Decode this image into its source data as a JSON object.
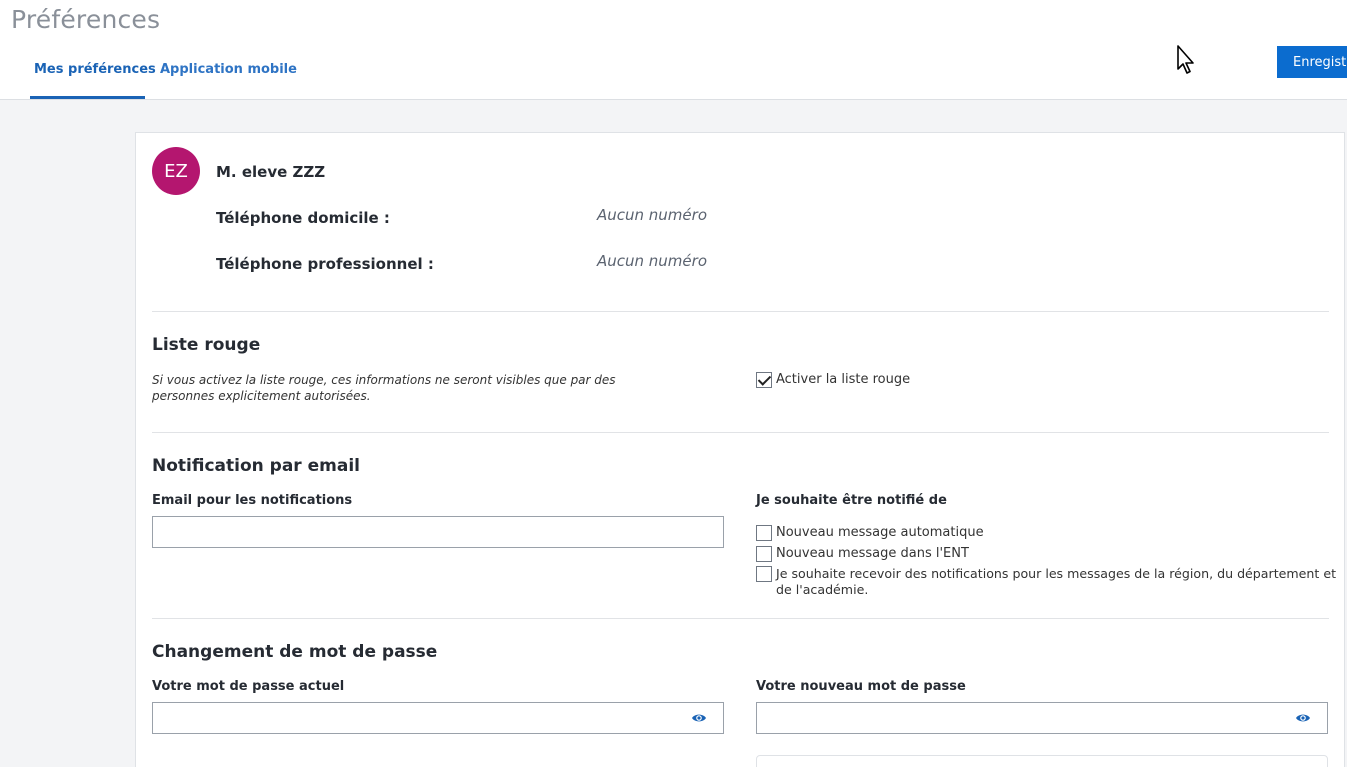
{
  "header": {
    "title": "Préférences",
    "tabs": [
      {
        "label": "Mes préférences",
        "active": true
      },
      {
        "label": "Application mobile",
        "active": false
      }
    ],
    "save_label": "Enregistrer"
  },
  "profile": {
    "initials": "EZ",
    "avatar_color": "#b4166f",
    "name": "M. eleve ZZZ",
    "phone_home_label": "Téléphone domicile :",
    "phone_home_value": "Aucun numéro",
    "phone_work_label": "Téléphone professionnel :",
    "phone_work_value": "Aucun numéro"
  },
  "liste_rouge": {
    "title": "Liste rouge",
    "help": "Si vous activez la liste rouge, ces informations ne seront visibles que par des personnes explicitement autorisées.",
    "checkbox_label": "Activer la liste rouge",
    "checked": true
  },
  "notification": {
    "title": "Notification par email",
    "email_label": "Email pour les notifications",
    "email_value": "",
    "notify_label": "Je souhaite être notifié de",
    "options": [
      {
        "label": "Nouveau message automatique",
        "checked": false
      },
      {
        "label": "Nouveau message dans l'ENT",
        "checked": false
      },
      {
        "label": "Je souhaite recevoir des notifications pour les messages de la région, du département et de l'académie.",
        "checked": false
      }
    ]
  },
  "password": {
    "title": "Changement de mot de passe",
    "current_label": "Votre mot de passe actuel",
    "new_label": "Votre nouveau mot de passe"
  },
  "colors": {
    "accent": "#0b6ccf",
    "tab_active": "#1a63b5"
  }
}
